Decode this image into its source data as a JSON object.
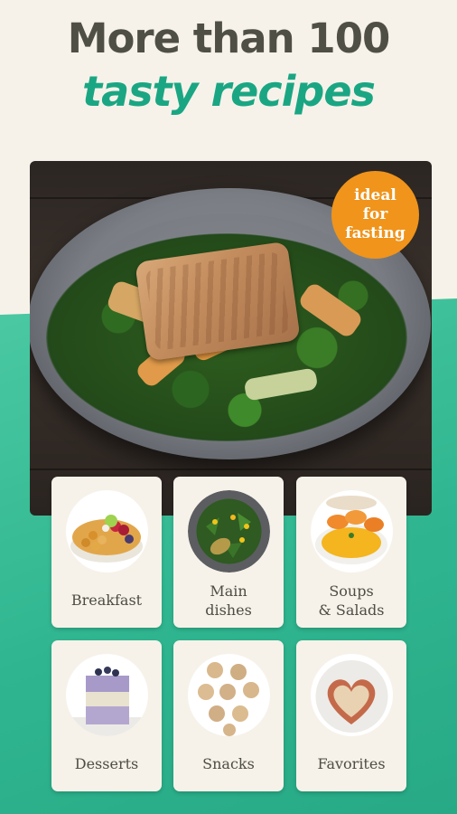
{
  "headline": {
    "line1": "More than 100",
    "line2": "tasty recipes"
  },
  "hero": {
    "badge": [
      "ideal",
      "for",
      "fasting"
    ]
  },
  "categories": [
    {
      "label": [
        "Breakfast"
      ],
      "icon": "breakfast-bowl-icon"
    },
    {
      "label": [
        "Main",
        "dishes"
      ],
      "icon": "main-dish-icon"
    },
    {
      "label": [
        "Soups",
        "& Salads"
      ],
      "icon": "soup-bowl-icon"
    },
    {
      "label": [
        "Desserts"
      ],
      "icon": "dessert-glass-icon"
    },
    {
      "label": [
        "Snacks"
      ],
      "icon": "snack-balls-icon"
    },
    {
      "label": [
        "Favorites"
      ],
      "icon": "heart-pancake-icon"
    }
  ],
  "colors": {
    "accent_green": "#1aa683",
    "badge_orange": "#f0941b",
    "background_cream": "#f6f2ea"
  }
}
